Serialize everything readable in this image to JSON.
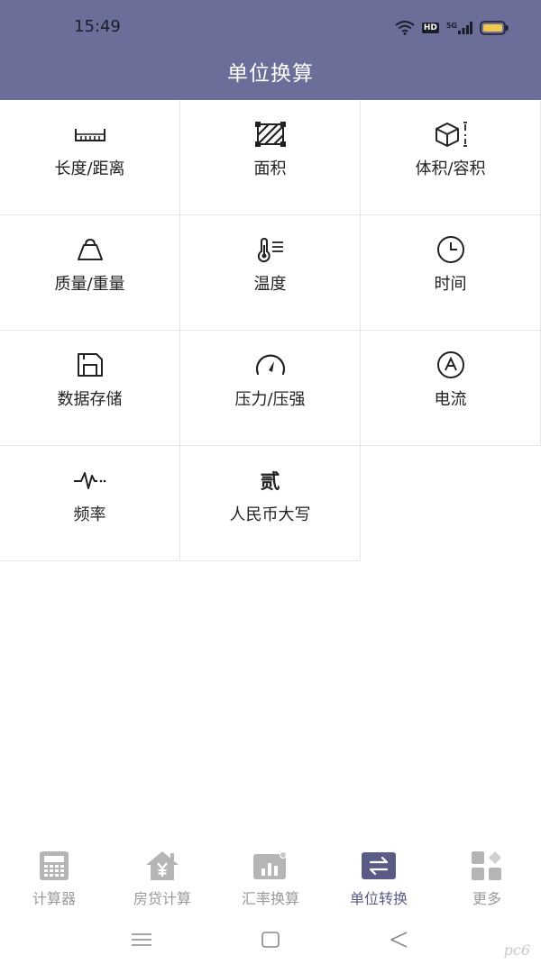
{
  "status_bar": {
    "time": "15:49",
    "hd_badge": "HD",
    "network": "5G"
  },
  "header": {
    "title": "单位换算"
  },
  "categories": [
    {
      "label": "长度/距离",
      "icon": "ruler-icon"
    },
    {
      "label": "面积",
      "icon": "area-icon"
    },
    {
      "label": "体积/容积",
      "icon": "cube-icon"
    },
    {
      "label": "质量/重量",
      "icon": "weight-icon"
    },
    {
      "label": "温度",
      "icon": "thermometer-icon"
    },
    {
      "label": "时间",
      "icon": "clock-icon"
    },
    {
      "label": "数据存储",
      "icon": "save-disk-icon"
    },
    {
      "label": "压力/压强",
      "icon": "gauge-icon"
    },
    {
      "label": "电流",
      "icon": "ampere-icon"
    },
    {
      "label": "频率",
      "icon": "waveform-icon"
    },
    {
      "label": "人民币大写",
      "icon": "rmb-capital-icon",
      "glyph": "贰"
    }
  ],
  "tabs": [
    {
      "label": "计算器",
      "icon": "calculator-icon",
      "active": false
    },
    {
      "label": "房贷计算",
      "icon": "house-yen-icon",
      "active": false
    },
    {
      "label": "汇率换算",
      "icon": "exchange-chart-icon",
      "active": false
    },
    {
      "label": "单位转换",
      "icon": "swap-arrows-icon",
      "active": true
    },
    {
      "label": "更多",
      "icon": "more-grid-icon",
      "active": false
    }
  ],
  "colors": {
    "header_bg": "#6b6e99",
    "active_tab": "#5a5c85",
    "inactive_tab": "#b5b5b5"
  },
  "watermark": "pc6"
}
